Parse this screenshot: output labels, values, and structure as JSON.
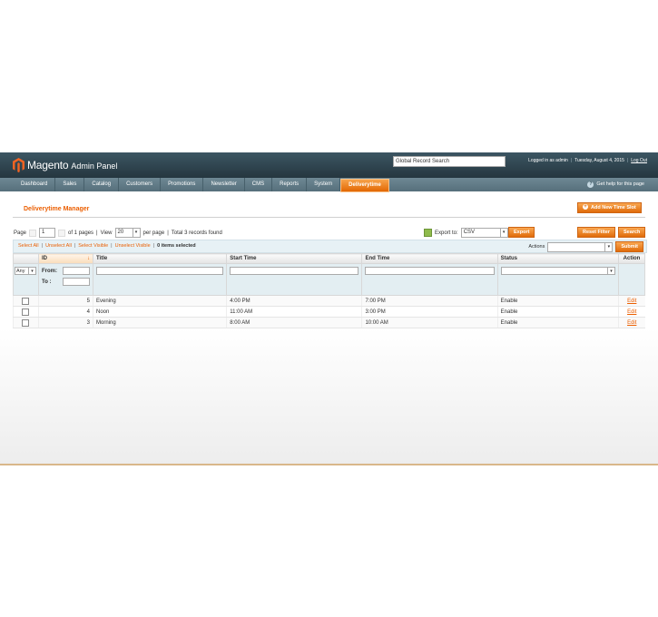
{
  "header": {
    "logo_text": "Magento",
    "logo_sub": "Admin Panel",
    "global_search_placeholder": "Global Record Search",
    "logged_in": "Logged in as admin",
    "date": "Tuesday, August 4, 2015",
    "logout": "Log Out"
  },
  "nav": {
    "items": [
      "Dashboard",
      "Sales",
      "Catalog",
      "Customers",
      "Promotions",
      "Newsletter",
      "CMS",
      "Reports",
      "System",
      "Deliverytime"
    ],
    "help": "Get help for this page"
  },
  "page": {
    "title": "Deliverytime Manager",
    "add_button": "Add New Time Slot"
  },
  "pager": {
    "page_label": "Page",
    "page_value": "1",
    "of_pages": "of 1 pages",
    "view_label": "View",
    "view_value": "20",
    "per_page": "per page",
    "total": "Total 3 records found"
  },
  "export": {
    "label": "Export to:",
    "value": "CSV",
    "button": "Export"
  },
  "grid_buttons": {
    "reset": "Reset Filter",
    "search": "Search"
  },
  "massaction": {
    "select_all": "Select All",
    "unselect_all": "Unselect All",
    "select_visible": "Select Visible",
    "unselect_visible": "Unselect Visible",
    "count": "0 items selected",
    "actions_label": "Actions",
    "submit": "Submit"
  },
  "grid": {
    "columns": [
      "ID",
      "Title",
      "Start Time",
      "End Time",
      "Status",
      "Action"
    ],
    "filter": {
      "any": "Any",
      "from": "From:",
      "to": "To :"
    },
    "rows": [
      {
        "id": "5",
        "title": "Evening",
        "start": "4:00 PM",
        "end": "7:00 PM",
        "status": "Enable",
        "action": "Edit"
      },
      {
        "id": "4",
        "title": "Noon",
        "start": "11:00 AM",
        "end": "3:00 PM",
        "status": "Enable",
        "action": "Edit"
      },
      {
        "id": "3",
        "title": "Morning",
        "start": "8:00 AM",
        "end": "10:00 AM",
        "status": "Enable",
        "action": "Edit"
      }
    ]
  },
  "colors": {
    "accent": "#eb5e00",
    "header": "#2f444f",
    "nav": "#5f7884",
    "massbar": "#e7f1f5"
  }
}
